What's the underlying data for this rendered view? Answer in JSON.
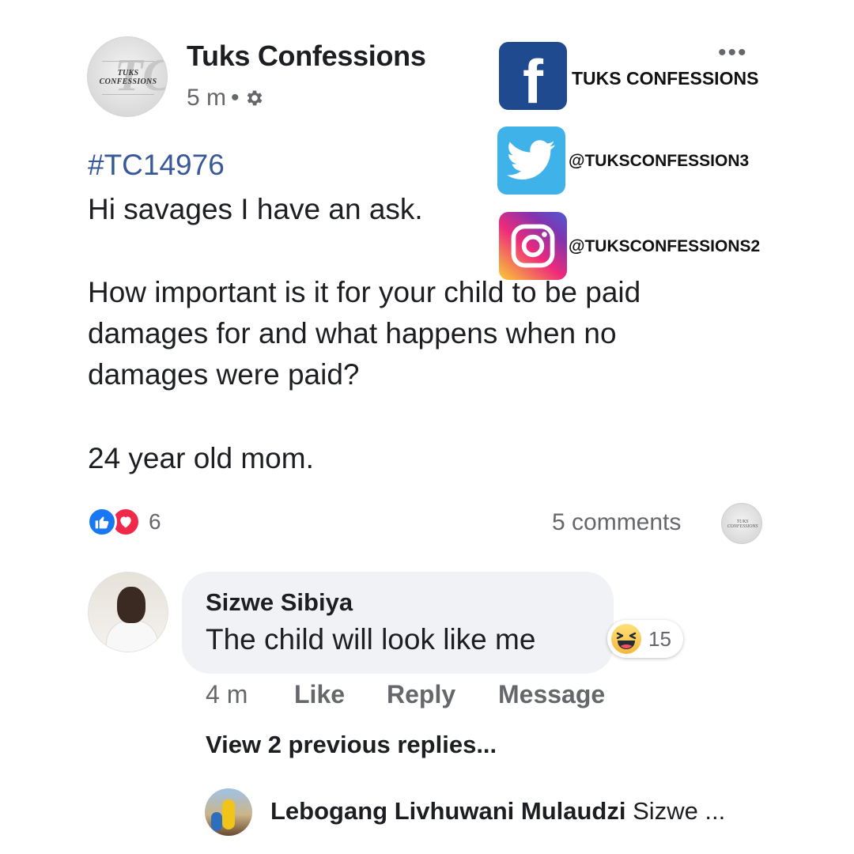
{
  "post": {
    "page_name": "Tuks Confessions",
    "avatar_text": "TUKS CONFESSIONS",
    "avatar_mark": "TC",
    "time": "5 m",
    "separator": "•",
    "privacy_icon": "gear-icon",
    "more_icon": "•••",
    "hashtag": "#TC14976",
    "lines": [
      "Hi savages I have an ask.",
      "How important is it for your child to be paid",
      "damages for and what happens when no",
      "damages were paid?",
      "24 year old mom."
    ]
  },
  "social": {
    "facebook": {
      "icon": "facebook-icon",
      "glyph": "f",
      "label": "TUKS CONFESSIONS",
      "color": "#1f4a8f"
    },
    "twitter": {
      "icon": "twitter-icon",
      "label": "@TUKSCONFESSION3",
      "color": "#3fb2ea"
    },
    "instagram": {
      "icon": "instagram-icon",
      "label": "@TUKSCONFESSIONS2"
    }
  },
  "stats": {
    "reaction_icons": [
      "like-icon",
      "love-icon"
    ],
    "reaction_count": "6",
    "comments_label": "5 comments"
  },
  "comment": {
    "author": "Sizwe Sibiya",
    "text": "The child will look like me",
    "reaction_icon": "haha-icon",
    "reaction_count": "15",
    "time": "4 m",
    "like_label": "Like",
    "reply_label": "Reply",
    "message_label": "Message",
    "view_replies_label": "View 2 previous replies..."
  },
  "reply": {
    "author": "Lebogang Livhuwani Mulaudzi",
    "text": "Sizwe ..."
  },
  "colors": {
    "link_blue": "#385898",
    "like_blue": "#1877f2",
    "love_red": "#f0284a",
    "muted_text": "#65676b",
    "bubble_bg": "#f0f2f5"
  }
}
